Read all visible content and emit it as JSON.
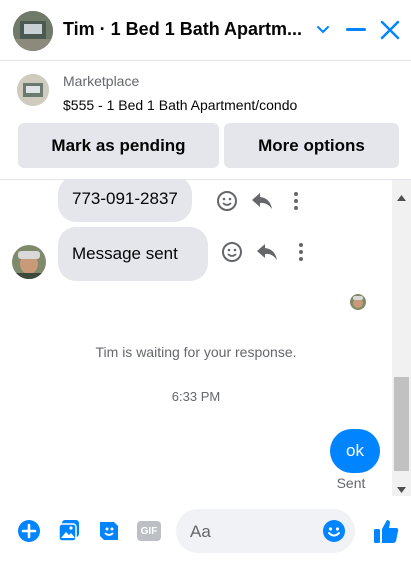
{
  "header": {
    "title": "Tim · 1 Bed 1 Bath Apartm...",
    "icons": [
      "chevron-down-icon",
      "minimize-icon",
      "close-icon"
    ]
  },
  "listing": {
    "source": "Marketplace",
    "title": "$555 - 1 Bed 1 Bath Apartment/condo",
    "mark_pending_label": "Mark as pending",
    "more_options_label": "More options"
  },
  "thread": {
    "messages": [
      {
        "text": "773-091-2837",
        "direction": "incoming"
      },
      {
        "text": "Message sent",
        "direction": "incoming"
      }
    ],
    "waiting_text": "Tim is waiting for your response.",
    "timestamp": "6:33 PM",
    "outgoing": {
      "text": "ok",
      "status": "Sent"
    }
  },
  "composer": {
    "placeholder": "Aa",
    "icons": [
      "add-icon",
      "photo-icon",
      "sticker-icon",
      "gif-icon",
      "emoji-icon",
      "like-icon"
    ],
    "gif_label": "GIF"
  },
  "colors": {
    "accent": "#0084ff",
    "bubble_incoming": "#e4e6eb",
    "muted_text": "#65676b"
  }
}
